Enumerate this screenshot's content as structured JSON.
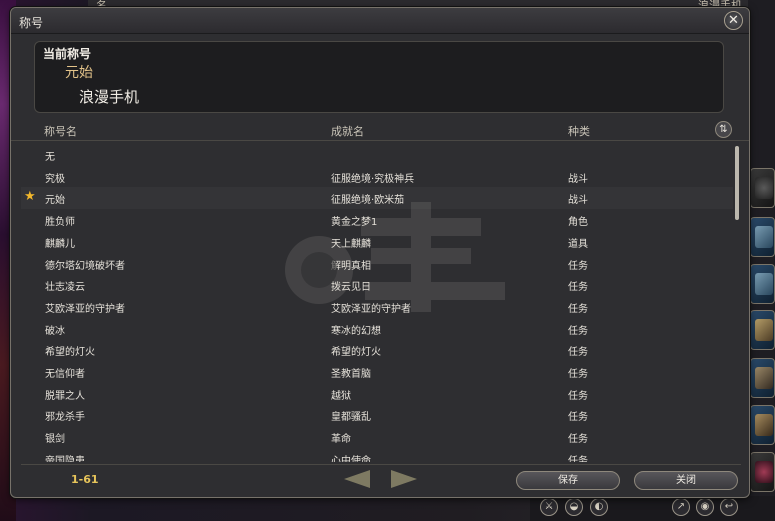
{
  "background": {
    "top_text_left": "名",
    "top_text_right": "浪漫手机"
  },
  "window": {
    "title": "称号",
    "close_icon": "close-x-icon"
  },
  "current_title": {
    "label": "当前称号",
    "prefix_title": "元始",
    "player_name": "浪漫手机"
  },
  "columns": {
    "title_name": "称号名",
    "achievement_name": "成就名",
    "category": "种类",
    "sort_icon": "sort-arrows-icon"
  },
  "rows": [
    {
      "title": "无",
      "achievement": "",
      "category": "",
      "current": false
    },
    {
      "title": "究极",
      "achievement": "征服绝境·究极神兵",
      "category": "战斗",
      "current": false
    },
    {
      "title": "元始",
      "achievement": "征服绝境·欧米茄",
      "category": "战斗",
      "current": true
    },
    {
      "title": "胜负师",
      "achievement": "黄金之梦1",
      "category": "角色",
      "current": false
    },
    {
      "title": "麒麟儿",
      "achievement": "天上麒麟",
      "category": "道具",
      "current": false
    },
    {
      "title": "德尔塔幻境破坏者",
      "achievement": "解明真相",
      "category": "任务",
      "current": false
    },
    {
      "title": "壮志凌云",
      "achievement": "拨云见日",
      "category": "任务",
      "current": false
    },
    {
      "title": "艾欧泽亚的守护者",
      "achievement": "艾欧泽亚的守护者",
      "category": "任务",
      "current": false
    },
    {
      "title": "破冰",
      "achievement": "寒冰的幻想",
      "category": "任务",
      "current": false
    },
    {
      "title": "希望的灯火",
      "achievement": "希望的灯火",
      "category": "任务",
      "current": false
    },
    {
      "title": "无信仰者",
      "achievement": "圣教首脑",
      "category": "任务",
      "current": false
    },
    {
      "title": "脱罪之人",
      "achievement": "越狱",
      "category": "任务",
      "current": false
    },
    {
      "title": "邪龙杀手",
      "achievement": "皇都骚乱",
      "category": "任务",
      "current": false
    },
    {
      "title": "银剑",
      "achievement": "革命",
      "category": "任务",
      "current": false
    },
    {
      "title": "帝国隐患",
      "achievement": "心中使命",
      "category": "任务",
      "current": false
    }
  ],
  "footer": {
    "page_range": "1-61",
    "prev_icon": "triangle-left-icon",
    "next_icon": "triangle-right-icon",
    "save_label": "保存",
    "close_label": "关闭"
  },
  "colors": {
    "accent_gold": "#e4c48a",
    "star": "#f3b82c",
    "page_range": "#e6c45a"
  }
}
